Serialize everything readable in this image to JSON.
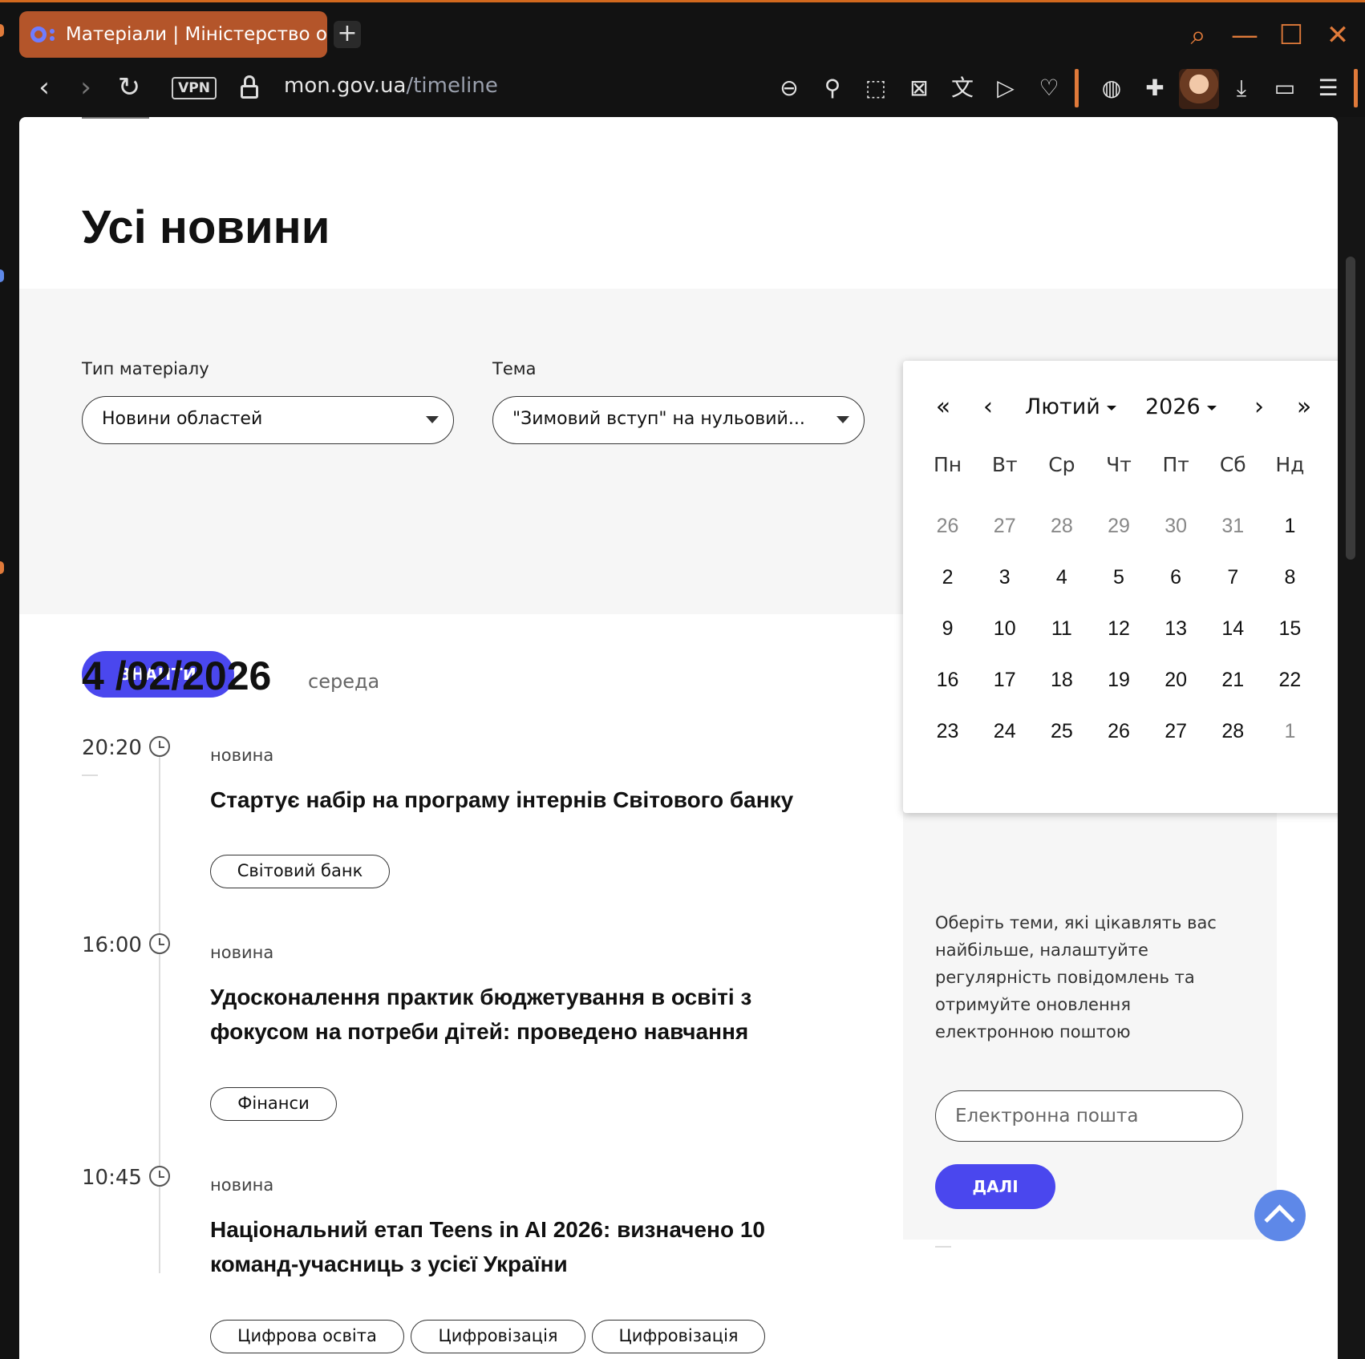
{
  "browser": {
    "tab_title": "Матеріали | Міністерство о",
    "new_tab_label": "+",
    "vpn_label": "VPN",
    "url_domain": "mon.gov.ua",
    "url_path": "/timeline"
  },
  "icons": {
    "search": "⌕",
    "minimize": "—",
    "maximize": "☐",
    "close": "✕",
    "back": "‹",
    "forward": "›",
    "reload": "↻",
    "zoom_out": "⊖",
    "pin": "⚲",
    "snapshot": "⬚",
    "adblock": "⊠",
    "translate": "文",
    "send": "▷",
    "heart": "♡",
    "globe": "◍",
    "extensions": "✚",
    "download": "⤓",
    "battery": "▭",
    "settings": "☰"
  },
  "page": {
    "title": "Усі новини"
  },
  "filters": {
    "type_label": "Тип матеріалу",
    "type_value": "Новини областей",
    "topic_label": "Тема",
    "topic_value": "\"Зимовий вступ\" на нульовий...",
    "search_button": "ЗНАЙТИ"
  },
  "date_section": {
    "date": "4 /02/2026",
    "weekday": "середа"
  },
  "news": [
    {
      "time": "20:20",
      "kind": "новина",
      "title": "Стартує набір на програму інтернів Світового банку",
      "tags": [
        "Світовий банк"
      ]
    },
    {
      "time": "16:00",
      "kind": "новина",
      "title": "Удосконалення практик бюджетування в освіті з фокусом на потреби дітей: проведено навчання",
      "tags": [
        "Фінанси"
      ]
    },
    {
      "time": "10:45",
      "kind": "новина",
      "title": "Національний етап Teens in AI 2026: визначено 10 команд-учасниць з усієї України",
      "tags": [
        "Цифрова освіта",
        "Цифровізація",
        "Цифровізація"
      ]
    }
  ],
  "calendar": {
    "first": "«",
    "prev": "‹",
    "next": "›",
    "last": "»",
    "month": "Лютий",
    "year": "2026",
    "weekdays": [
      "Пн",
      "Вт",
      "Ср",
      "Чт",
      "Пт",
      "Сб",
      "Нд"
    ],
    "days": [
      {
        "d": "26",
        "m": true
      },
      {
        "d": "27",
        "m": true
      },
      {
        "d": "28",
        "m": true
      },
      {
        "d": "29",
        "m": true
      },
      {
        "d": "30",
        "m": true
      },
      {
        "d": "31",
        "m": true
      },
      {
        "d": "1",
        "m": false
      },
      {
        "d": "2",
        "m": false
      },
      {
        "d": "3",
        "m": false
      },
      {
        "d": "4",
        "m": false
      },
      {
        "d": "5",
        "m": false
      },
      {
        "d": "6",
        "m": false
      },
      {
        "d": "7",
        "m": false
      },
      {
        "d": "8",
        "m": false
      },
      {
        "d": "9",
        "m": false
      },
      {
        "d": "10",
        "m": false
      },
      {
        "d": "11",
        "m": false
      },
      {
        "d": "12",
        "m": false
      },
      {
        "d": "13",
        "m": false
      },
      {
        "d": "14",
        "m": false
      },
      {
        "d": "15",
        "m": false
      },
      {
        "d": "16",
        "m": false
      },
      {
        "d": "17",
        "m": false
      },
      {
        "d": "18",
        "m": false
      },
      {
        "d": "19",
        "m": false
      },
      {
        "d": "20",
        "m": false
      },
      {
        "d": "21",
        "m": false
      },
      {
        "d": "22",
        "m": false
      },
      {
        "d": "23",
        "m": false
      },
      {
        "d": "24",
        "m": false
      },
      {
        "d": "25",
        "m": false
      },
      {
        "d": "26",
        "m": false
      },
      {
        "d": "27",
        "m": false
      },
      {
        "d": "28",
        "m": false
      },
      {
        "d": "1",
        "m": true
      }
    ]
  },
  "subscribe": {
    "text": "Оберіть теми, які цікавлять вас найбільше, налаштуйте регулярність повідомлень та отримуйте оновлення електронною поштою",
    "email_placeholder": "Електронна пошта",
    "next_button": "ДАЛІ"
  },
  "colors": {
    "accent": "#4a47ee",
    "browser_accent": "#e07a3a",
    "tab_bg": "#b4552a",
    "scroll_top": "#5e88e8"
  }
}
